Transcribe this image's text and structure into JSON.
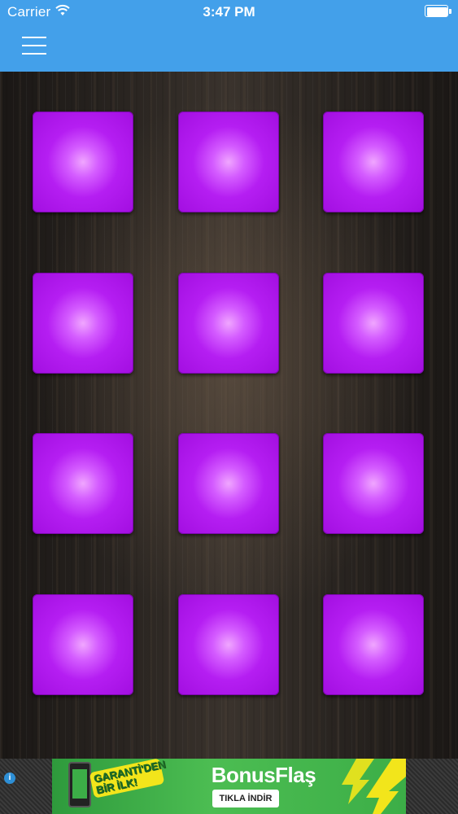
{
  "status_bar": {
    "carrier": "Carrier",
    "time": "3:47 PM"
  },
  "nav": {
    "menu_icon": "hamburger-menu-icon"
  },
  "colors": {
    "nav_background": "#43a0ea",
    "pad_color": "#b51ef2",
    "pad_highlight": "#f0a6ff"
  },
  "pads": {
    "rows": 4,
    "columns": 3
  },
  "ad": {
    "slogan_line1": "GARANTİ'DEN",
    "slogan_line2": "BİR İLK!",
    "title": "BonusFlaş",
    "cta": "TIKLA İNDİR"
  }
}
